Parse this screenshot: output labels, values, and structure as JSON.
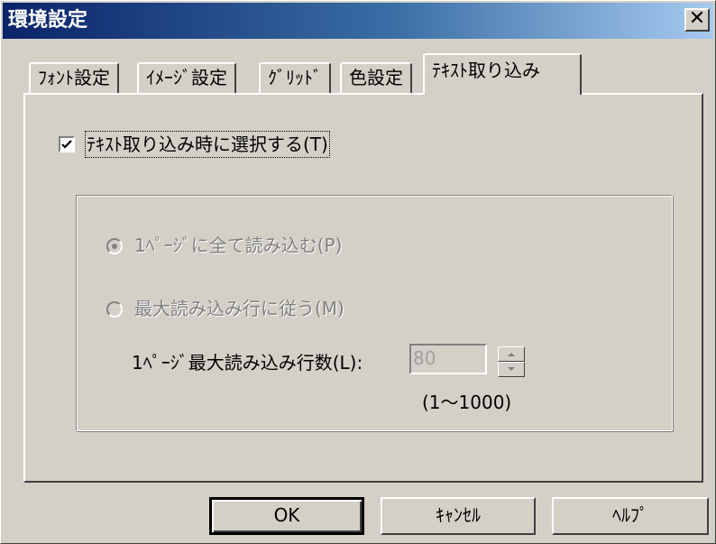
{
  "window": {
    "title": "環境設定",
    "close_label": "✕"
  },
  "tabs": [
    {
      "label": "ﾌｫﾝﾄ設定",
      "active": false
    },
    {
      "label": "ｲﾒｰｼﾞ設定",
      "active": false
    },
    {
      "label": "ｸﾞﾘｯﾄﾞ",
      "active": false
    },
    {
      "label": "色設定",
      "active": false
    },
    {
      "label": "ﾃｷｽﾄ取り込み",
      "active": true
    }
  ],
  "text_import": {
    "select_on_import": {
      "label": "ﾃｷｽﾄ取り込み時に選択する(T)",
      "checked": true
    },
    "load_mode": {
      "options": [
        {
          "label": "1ﾍﾟｰｼﾞに全て読み込む(P)",
          "selected": true,
          "enabled": false
        },
        {
          "label": "最大読み込み行に従う(M)",
          "selected": false,
          "enabled": false
        }
      ]
    },
    "max_lines": {
      "label": "1ﾍﾟｰｼﾞ最大読み込み行数(L):",
      "value": "80",
      "range": "(1～1000)",
      "enabled": false
    }
  },
  "buttons": {
    "ok": "OK",
    "cancel": "ｷｬﾝｾﾙ",
    "help": "ﾍﾙﾌﾟ"
  },
  "colors": {
    "face": "#d4d0c8",
    "title_start": "#0a246a",
    "title_end": "#a6caf0"
  }
}
